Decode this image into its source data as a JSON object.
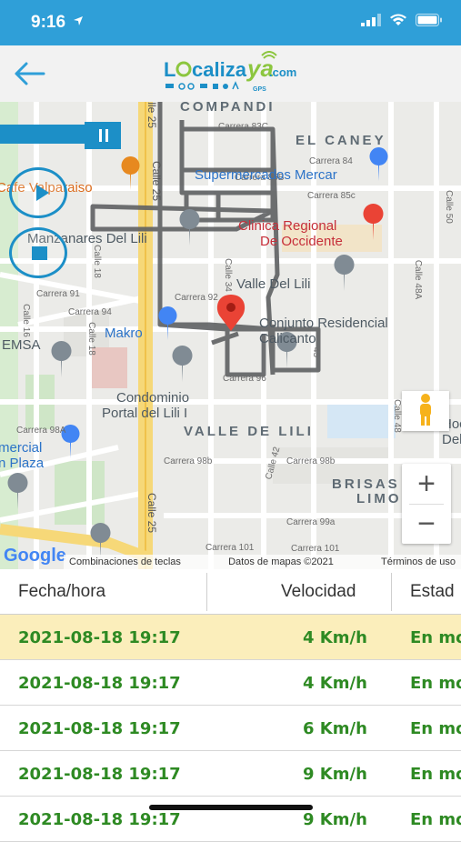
{
  "status_bar": {
    "time": "9:16",
    "icons": [
      "location-arrow-icon",
      "cellular-signal-icon",
      "wifi-icon",
      "battery-icon"
    ]
  },
  "header": {
    "back_icon": "back-arrow-icon",
    "logo": {
      "text": "Localizaya.com",
      "sub": "GPS"
    }
  },
  "map": {
    "labels": {
      "compandi": "COMPANDI",
      "el_caney": "EL CANEY",
      "carrera_83c": "Carrera 83C",
      "carrera_84": "Carrera 84",
      "carrera_85b": "Carrera 85B",
      "carrera_85c": "Carrera 85c",
      "calle_25_top": "Calle 25",
      "calle_25_mid": "Calle 25",
      "calle_25_bottom": "Calle 25",
      "supermercados": "Supermercados Mercar",
      "cafe": "Cafe Valparaiso",
      "clinica_1": "Clinica Regional",
      "clinica_2": "De Occidente",
      "calle_50": "Calle 50",
      "manzanares": "Manzanares Del Lili",
      "calle_34": "Calle 34",
      "calle_18_top": "Calle 18",
      "carrera_91": "Carrera 91",
      "carrera_92": "Carrera 92",
      "carrera_94": "Carrera 94",
      "calle_16": "Calle 16",
      "valle_del_lili": "Valle Del Lili",
      "calle_48a": "Calle 48A",
      "makro": "Makro",
      "conjunto_1": "Conjunto Residencial",
      "conjunto_2": "Calicanto",
      "emsa": "EMSA",
      "calle_18_bottom": "Calle 18",
      "carrera_96": "Carrera 96",
      "calle_45": "45",
      "condominio_1": "Condominio",
      "condominio_2": "Portal del Lili I",
      "valle_de_lili": "VALLE DE LILI",
      "calle_48": "Calle 48",
      "hoc": "Hoc",
      "del": "Del",
      "carrera_98a": "Carrera 98A",
      "comercial_1": "mercial",
      "comercial_2": "n Plaza",
      "carrera_98b_1": "Carrera 98b",
      "carrera_98b_2": "Carrera 98b",
      "calle_42": "Calle 42",
      "brisas": "BRISAS",
      "limon": "LIMON",
      "carrera_99a": "Carrera 99a",
      "carrera_101_1": "Carrera 101",
      "carrera_101_2": "Carrera 101"
    },
    "google_logo": "Google",
    "attribution": {
      "shortcuts": "Combinaciones de teclas",
      "map_data": "Datos de mapas ©2021",
      "terms": "Términos de uso"
    },
    "controls": {
      "pause_icon": "pause-icon",
      "play_icon": "play-icon",
      "stop_icon": "stop-icon",
      "pegman_icon": "pegman-icon",
      "zoom_in": "+",
      "zoom_out": "−"
    },
    "colors": {
      "route": "#5f6163",
      "marker": "#ea4335",
      "controls": "#1c8fc7"
    }
  },
  "table": {
    "headers": {
      "datetime": "Fecha/hora",
      "speed": "Velocidad",
      "status": "Estad"
    },
    "rows": [
      {
        "datetime": "2021-08-18 19:17",
        "speed": "4 Km/h",
        "status": "En mo"
      },
      {
        "datetime": "2021-08-18 19:17",
        "speed": "4 Km/h",
        "status": "En mo"
      },
      {
        "datetime": "2021-08-18 19:17",
        "speed": "6 Km/h",
        "status": "En mo"
      },
      {
        "datetime": "2021-08-18 19:17",
        "speed": "9 Km/h",
        "status": "En mo"
      },
      {
        "datetime": "2021-08-18 19:17",
        "speed": "9 Km/h",
        "status": "En mo"
      }
    ],
    "colors": {
      "highlight_row": "#fbeebb",
      "value_text": "#2e8a23"
    }
  }
}
